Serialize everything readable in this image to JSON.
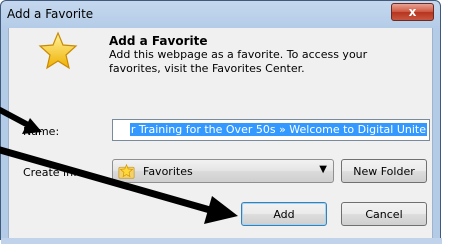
{
  "window": {
    "title": "Add a Favorite",
    "close_label": "x"
  },
  "header": {
    "title": "Add a Favorite",
    "description": "Add this webpage as a favorite. To access your favorites, visit the Favorites Center."
  },
  "form": {
    "name_label": "Name:",
    "name_value": "r Training for the Over 50s » Welcome to Digital Unite",
    "create_in_label": "Create in:",
    "create_in_value": "Favorites",
    "new_folder_label": "New Folder"
  },
  "buttons": {
    "add_label": "Add",
    "cancel_label": "Cancel"
  },
  "icons": {
    "header": "star-icon",
    "folder": "favorites-star-icon",
    "close": "close-icon"
  },
  "colors": {
    "selection": "#3399ff",
    "title_bar": "#c4d7ee",
    "close_button": "#cf5a43",
    "annotation_arrow": "#000000"
  }
}
